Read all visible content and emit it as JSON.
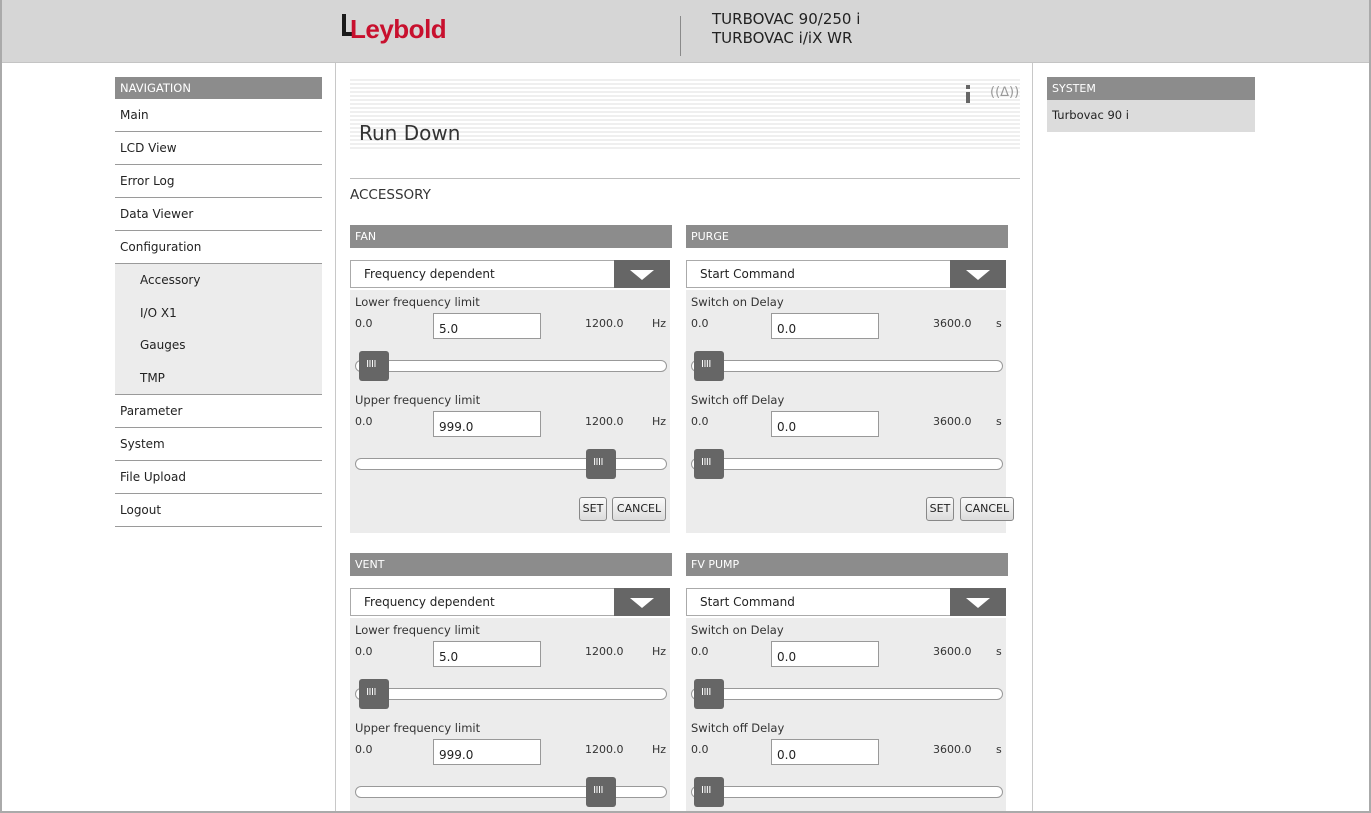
{
  "header": {
    "logo_text": "Leybold",
    "product_line1": "TURBOVAC 90/250 i",
    "product_line2": "TURBOVAC i/iX WR"
  },
  "nav": {
    "heading": "NAVIGATION",
    "items": [
      {
        "label": "Main"
      },
      {
        "label": "LCD View"
      },
      {
        "label": "Error Log"
      },
      {
        "label": "Data Viewer"
      },
      {
        "label": "Configuration"
      }
    ],
    "config_sub": [
      {
        "label": "Accessory"
      },
      {
        "label": "I/O X1"
      },
      {
        "label": "Gauges"
      },
      {
        "label": "TMP"
      }
    ],
    "items_after": [
      {
        "label": "Parameter"
      },
      {
        "label": "System"
      },
      {
        "label": "File Upload"
      },
      {
        "label": "Logout"
      }
    ]
  },
  "page": {
    "title": "Run Down",
    "section": "ACCESSORY",
    "icons": [
      "info-icon",
      "signal-icon"
    ]
  },
  "panels": {
    "fan": {
      "heading": "FAN",
      "mode": "Frequency dependent",
      "row1": {
        "label": "Lower frequency limit",
        "min": "0.0",
        "value": "5.0",
        "max": "1200.0",
        "unit": "Hz",
        "fraction": 0.004
      },
      "row2": {
        "label": "Upper frequency limit",
        "min": "0.0",
        "value": "999.0",
        "max": "1200.0",
        "unit": "Hz",
        "fraction": 0.8325
      },
      "set_label": "SET",
      "cancel_label": "CANCEL"
    },
    "purge": {
      "heading": "PURGE",
      "mode": "Start Command",
      "row1": {
        "label": "Switch on Delay",
        "min": "0.0",
        "value": "0.0",
        "max": "3600.0",
        "unit": "s",
        "fraction": 0.0
      },
      "row2": {
        "label": "Switch off Delay",
        "min": "0.0",
        "value": "0.0",
        "max": "3600.0",
        "unit": "s",
        "fraction": 0.0
      },
      "set_label": "SET",
      "cancel_label": "CANCEL"
    },
    "vent": {
      "heading": "VENT",
      "mode": "Frequency dependent",
      "row1": {
        "label": "Lower frequency limit",
        "min": "0.0",
        "value": "5.0",
        "max": "1200.0",
        "unit": "Hz",
        "fraction": 0.004
      },
      "row2": {
        "label": "Upper frequency limit",
        "min": "0.0",
        "value": "999.0",
        "max": "1200.0",
        "unit": "Hz",
        "fraction": 0.8325
      }
    },
    "fvpump": {
      "heading": "FV PUMP",
      "mode": "Start Command",
      "row1": {
        "label": "Switch on Delay",
        "min": "0.0",
        "value": "0.0",
        "max": "3600.0",
        "unit": "s",
        "fraction": 0.0
      },
      "row2": {
        "label": "Switch off Delay",
        "min": "0.0",
        "value": "0.0",
        "max": "3600.0",
        "unit": "s",
        "fraction": 0.0
      }
    }
  },
  "system": {
    "heading": "SYSTEM",
    "item": "Turbovac 90 i"
  },
  "colors": {
    "brand_red": "#c8102e",
    "panel_header": "#8c8c8c",
    "panel_body": "#ececec",
    "thumb": "#666666"
  }
}
